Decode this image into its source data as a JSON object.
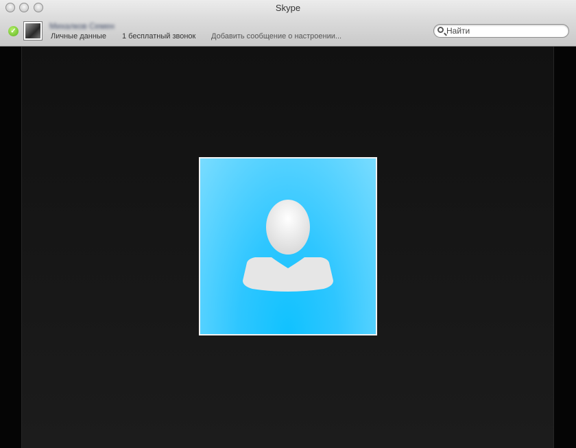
{
  "window": {
    "title": "Skype"
  },
  "account": {
    "name": "Михалков Семен",
    "menu": {
      "personal": "Личные данные",
      "free_call": "1 бесплатный звонок",
      "mood": "Добавить сообщение о настроении..."
    },
    "status": "online"
  },
  "search": {
    "placeholder": "Найти",
    "value": ""
  },
  "icons": {
    "status": "check-icon",
    "search": "magnifier-icon",
    "avatar": "default-user-icon"
  },
  "colors": {
    "status_online": "#5ab21d",
    "avatar_blue": "#10c2ff",
    "background": "#111111"
  }
}
